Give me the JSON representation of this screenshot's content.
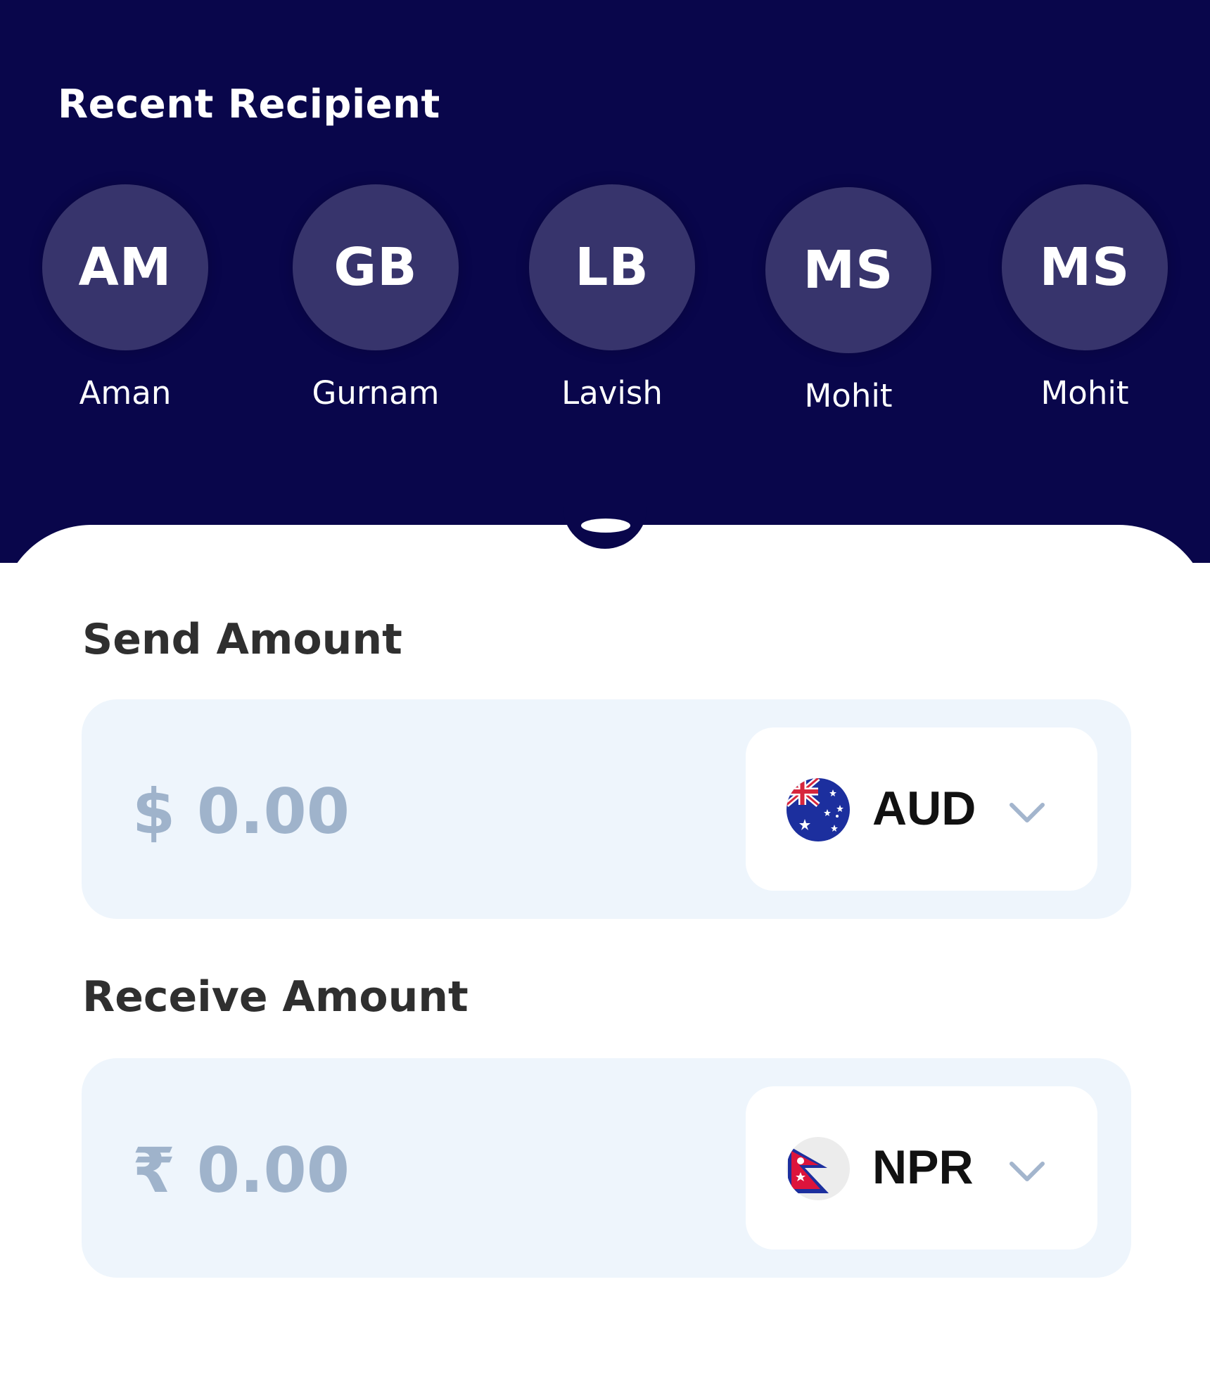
{
  "recent": {
    "title": "Recent Recipient",
    "recipients": [
      {
        "initials": "AM",
        "name": "Aman"
      },
      {
        "initials": "GB",
        "name": "Gurnam"
      },
      {
        "initials": "LB",
        "name": "Lavish"
      },
      {
        "initials": "MS",
        "name": "Mohit"
      },
      {
        "initials": "MS",
        "name": "Mohit"
      }
    ]
  },
  "send": {
    "label": "Send Amount",
    "amount": "$ 0.00",
    "currency": "AUD",
    "flag_icon": "australia-flag-icon"
  },
  "receive": {
    "label": "Receive Amount",
    "amount": "₹ 0.00",
    "currency": "NPR",
    "flag_icon": "nepal-flag-icon"
  },
  "colors": {
    "header_bg": "#09064b",
    "avatar_bg": "#37346c",
    "field_bg": "#eef5fc",
    "placeholder_amount": "#9fb3cb",
    "chevron": "#a3b5cd"
  }
}
